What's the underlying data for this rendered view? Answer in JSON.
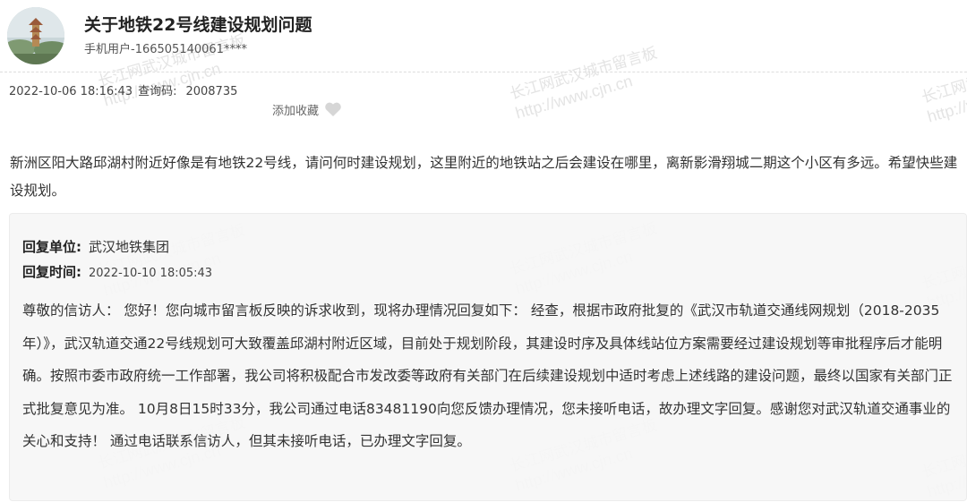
{
  "header": {
    "title": "关于地铁22号线建设规划问题",
    "user": "手机用户-166505140061****"
  },
  "meta": {
    "datetime": "2022-10-06 18:16:43",
    "query_label": "查询码:",
    "query_code": "2008735",
    "favorite_label": "添加收藏"
  },
  "question": "新洲区阳大路邱湖村附近好像是有地铁22号线，请问何时建设规划，这里附近的地铁站之后会建设在哪里，离新影滑翔城二期这个小区有多远。希望快些建设规划。",
  "reply": {
    "unit_label": "回复单位:",
    "unit": "武汉地铁集团",
    "time_label": "回复时间:",
    "time": "2022-10-10 18:05:43",
    "answer": "尊敬的信访人： 您好！您向城市留言板反映的诉求收到，现将办理情况回复如下： 经查，根据市政府批复的《武汉市轨道交通线网规划（2018-2035年）》，武汉轨道交通22号线规划可大致覆盖邱湖村附近区域，目前处于规划阶段，其建设时序及具体线站位方案需要经过建设规划等审批程序后才能明确。按照市委市政府统一工作部署，我公司将积极配合市发改委等政府有关部门在后续建设规划中适时考虑上述线路的建设问题，最终以国家有关部门正式批复意见为准。 10月8日15时33分，我公司通过电话83481190向您反馈办理情况，您未接听电话，故办理文字回复。感谢您对武汉轨道交通事业的关心和支持！ 通过电话联系信访人，但其未接听电话，已办理文字回复。"
  },
  "watermark": {
    "text": "长江网武汉城市留言板",
    "url": "http://www.cjn.cn"
  },
  "icons": {
    "favorite": "heart-icon",
    "avatar": "avatar-image"
  },
  "colors": {
    "heart": "#d6d6d6",
    "reply_bg": "#f6f6f6"
  }
}
